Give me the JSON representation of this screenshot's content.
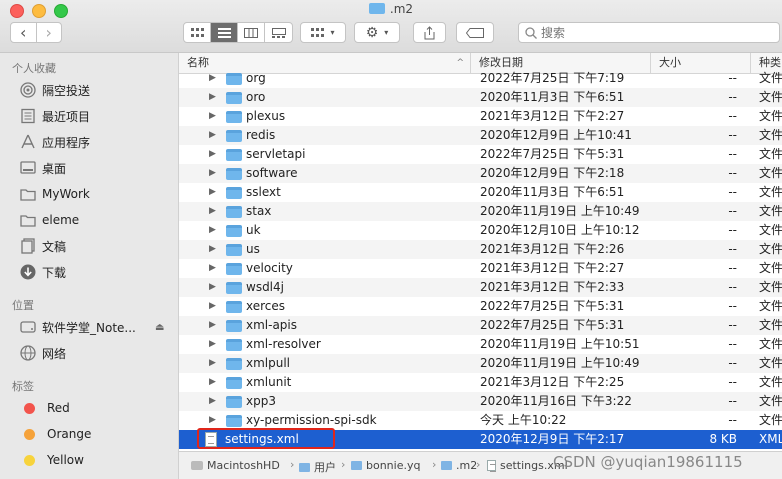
{
  "window": {
    "title": ".m2"
  },
  "toolbar": {
    "back_glyph": "‹",
    "forward_glyph": "›",
    "search_placeholder": "搜索"
  },
  "sidebar": {
    "favorites_header": "个人收藏",
    "favorites": [
      {
        "label": "隔空投送",
        "icon": "airdrop-icon"
      },
      {
        "label": "最近项目",
        "icon": "recents-icon"
      },
      {
        "label": "应用程序",
        "icon": "applications-icon"
      },
      {
        "label": "桌面",
        "icon": "desktop-icon"
      },
      {
        "label": "MyWork",
        "icon": "folder-icon"
      },
      {
        "label": "eleme",
        "icon": "folder-icon"
      },
      {
        "label": "文稿",
        "icon": "documents-icon"
      },
      {
        "label": "下载",
        "icon": "downloads-icon"
      }
    ],
    "locations_header": "位置",
    "locations": [
      {
        "label": "软件学堂_Note...",
        "icon": "drive-icon"
      },
      {
        "label": "网络",
        "icon": "network-icon"
      }
    ],
    "tags_header": "标签",
    "tags": [
      {
        "label": "Red",
        "color": "#f2544c"
      },
      {
        "label": "Orange",
        "color": "#f5a23a"
      },
      {
        "label": "Yellow",
        "color": "#f7d33c"
      }
    ]
  },
  "columns": {
    "name": "名称",
    "date": "修改日期",
    "size": "大小",
    "kind": "种类"
  },
  "files": [
    {
      "name": "org",
      "date": "2022年7月25日 下午7:19",
      "size": "--",
      "kind": "文件"
    },
    {
      "name": "oro",
      "date": "2020年11月3日 下午6:51",
      "size": "--",
      "kind": "文件"
    },
    {
      "name": "plexus",
      "date": "2021年3月12日 下午2:27",
      "size": "--",
      "kind": "文件"
    },
    {
      "name": "redis",
      "date": "2020年12月9日 上午10:41",
      "size": "--",
      "kind": "文件"
    },
    {
      "name": "servletapi",
      "date": "2022年7月25日 下午5:31",
      "size": "--",
      "kind": "文件"
    },
    {
      "name": "software",
      "date": "2020年12月9日 下午2:18",
      "size": "--",
      "kind": "文件"
    },
    {
      "name": "sslext",
      "date": "2020年11月3日 下午6:51",
      "size": "--",
      "kind": "文件"
    },
    {
      "name": "stax",
      "date": "2020年11月19日 上午10:49",
      "size": "--",
      "kind": "文件"
    },
    {
      "name": "uk",
      "date": "2020年12月10日 上午10:12",
      "size": "--",
      "kind": "文件"
    },
    {
      "name": "us",
      "date": "2021年3月12日 下午2:26",
      "size": "--",
      "kind": "文件"
    },
    {
      "name": "velocity",
      "date": "2021年3月12日 下午2:27",
      "size": "--",
      "kind": "文件"
    },
    {
      "name": "wsdl4j",
      "date": "2021年3月12日 下午2:33",
      "size": "--",
      "kind": "文件"
    },
    {
      "name": "xerces",
      "date": "2022年7月25日 下午5:31",
      "size": "--",
      "kind": "文件"
    },
    {
      "name": "xml-apis",
      "date": "2022年7月25日 下午5:31",
      "size": "--",
      "kind": "文件"
    },
    {
      "name": "xml-resolver",
      "date": "2020年11月19日 上午10:51",
      "size": "--",
      "kind": "文件"
    },
    {
      "name": "xmlpull",
      "date": "2020年11月19日 上午10:49",
      "size": "--",
      "kind": "文件"
    },
    {
      "name": "xmlunit",
      "date": "2021年3月12日 下午2:25",
      "size": "--",
      "kind": "文件"
    },
    {
      "name": "xpp3",
      "date": "2020年11月16日 下午3:22",
      "size": "--",
      "kind": "文件"
    },
    {
      "name": "xy-permission-spi-sdk",
      "date": "今天 上午10:22",
      "size": "--",
      "kind": "文件"
    }
  ],
  "selected_file": {
    "name": "settings.xml",
    "date": "2020年12月9日 下午2:17",
    "size": "8 KB",
    "kind": "XML"
  },
  "pathbar": [
    "MacintoshHD",
    "用户",
    "bonnie.yq",
    ".m2",
    "settings.xml"
  ],
  "watermark": "CSDN @yuqian19861115"
}
